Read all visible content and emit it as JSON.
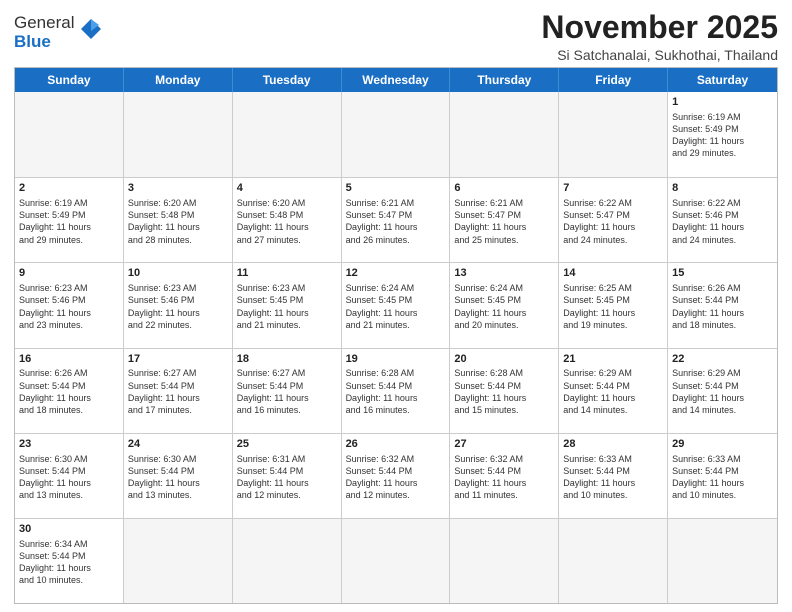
{
  "header": {
    "logo_general": "General",
    "logo_blue": "Blue",
    "month_title": "November 2025",
    "location": "Si Satchanalai, Sukhothai, Thailand"
  },
  "weekdays": [
    "Sunday",
    "Monday",
    "Tuesday",
    "Wednesday",
    "Thursday",
    "Friday",
    "Saturday"
  ],
  "rows": [
    [
      {
        "day": "",
        "text": "",
        "empty": true
      },
      {
        "day": "",
        "text": "",
        "empty": true
      },
      {
        "day": "",
        "text": "",
        "empty": true
      },
      {
        "day": "",
        "text": "",
        "empty": true
      },
      {
        "day": "",
        "text": "",
        "empty": true
      },
      {
        "day": "",
        "text": "",
        "empty": true
      },
      {
        "day": "1",
        "text": "Sunrise: 6:19 AM\nSunset: 5:49 PM\nDaylight: 11 hours\nand 29 minutes.",
        "empty": false
      }
    ],
    [
      {
        "day": "2",
        "text": "Sunrise: 6:19 AM\nSunset: 5:49 PM\nDaylight: 11 hours\nand 29 minutes.",
        "empty": false
      },
      {
        "day": "3",
        "text": "Sunrise: 6:20 AM\nSunset: 5:48 PM\nDaylight: 11 hours\nand 28 minutes.",
        "empty": false
      },
      {
        "day": "4",
        "text": "Sunrise: 6:20 AM\nSunset: 5:48 PM\nDaylight: 11 hours\nand 27 minutes.",
        "empty": false
      },
      {
        "day": "5",
        "text": "Sunrise: 6:21 AM\nSunset: 5:47 PM\nDaylight: 11 hours\nand 26 minutes.",
        "empty": false
      },
      {
        "day": "6",
        "text": "Sunrise: 6:21 AM\nSunset: 5:47 PM\nDaylight: 11 hours\nand 25 minutes.",
        "empty": false
      },
      {
        "day": "7",
        "text": "Sunrise: 6:22 AM\nSunset: 5:47 PM\nDaylight: 11 hours\nand 24 minutes.",
        "empty": false
      },
      {
        "day": "8",
        "text": "Sunrise: 6:22 AM\nSunset: 5:46 PM\nDaylight: 11 hours\nand 24 minutes.",
        "empty": false
      }
    ],
    [
      {
        "day": "9",
        "text": "Sunrise: 6:23 AM\nSunset: 5:46 PM\nDaylight: 11 hours\nand 23 minutes.",
        "empty": false
      },
      {
        "day": "10",
        "text": "Sunrise: 6:23 AM\nSunset: 5:46 PM\nDaylight: 11 hours\nand 22 minutes.",
        "empty": false
      },
      {
        "day": "11",
        "text": "Sunrise: 6:23 AM\nSunset: 5:45 PM\nDaylight: 11 hours\nand 21 minutes.",
        "empty": false
      },
      {
        "day": "12",
        "text": "Sunrise: 6:24 AM\nSunset: 5:45 PM\nDaylight: 11 hours\nand 21 minutes.",
        "empty": false
      },
      {
        "day": "13",
        "text": "Sunrise: 6:24 AM\nSunset: 5:45 PM\nDaylight: 11 hours\nand 20 minutes.",
        "empty": false
      },
      {
        "day": "14",
        "text": "Sunrise: 6:25 AM\nSunset: 5:45 PM\nDaylight: 11 hours\nand 19 minutes.",
        "empty": false
      },
      {
        "day": "15",
        "text": "Sunrise: 6:26 AM\nSunset: 5:44 PM\nDaylight: 11 hours\nand 18 minutes.",
        "empty": false
      }
    ],
    [
      {
        "day": "16",
        "text": "Sunrise: 6:26 AM\nSunset: 5:44 PM\nDaylight: 11 hours\nand 18 minutes.",
        "empty": false
      },
      {
        "day": "17",
        "text": "Sunrise: 6:27 AM\nSunset: 5:44 PM\nDaylight: 11 hours\nand 17 minutes.",
        "empty": false
      },
      {
        "day": "18",
        "text": "Sunrise: 6:27 AM\nSunset: 5:44 PM\nDaylight: 11 hours\nand 16 minutes.",
        "empty": false
      },
      {
        "day": "19",
        "text": "Sunrise: 6:28 AM\nSunset: 5:44 PM\nDaylight: 11 hours\nand 16 minutes.",
        "empty": false
      },
      {
        "day": "20",
        "text": "Sunrise: 6:28 AM\nSunset: 5:44 PM\nDaylight: 11 hours\nand 15 minutes.",
        "empty": false
      },
      {
        "day": "21",
        "text": "Sunrise: 6:29 AM\nSunset: 5:44 PM\nDaylight: 11 hours\nand 14 minutes.",
        "empty": false
      },
      {
        "day": "22",
        "text": "Sunrise: 6:29 AM\nSunset: 5:44 PM\nDaylight: 11 hours\nand 14 minutes.",
        "empty": false
      }
    ],
    [
      {
        "day": "23",
        "text": "Sunrise: 6:30 AM\nSunset: 5:44 PM\nDaylight: 11 hours\nand 13 minutes.",
        "empty": false
      },
      {
        "day": "24",
        "text": "Sunrise: 6:30 AM\nSunset: 5:44 PM\nDaylight: 11 hours\nand 13 minutes.",
        "empty": false
      },
      {
        "day": "25",
        "text": "Sunrise: 6:31 AM\nSunset: 5:44 PM\nDaylight: 11 hours\nand 12 minutes.",
        "empty": false
      },
      {
        "day": "26",
        "text": "Sunrise: 6:32 AM\nSunset: 5:44 PM\nDaylight: 11 hours\nand 12 minutes.",
        "empty": false
      },
      {
        "day": "27",
        "text": "Sunrise: 6:32 AM\nSunset: 5:44 PM\nDaylight: 11 hours\nand 11 minutes.",
        "empty": false
      },
      {
        "day": "28",
        "text": "Sunrise: 6:33 AM\nSunset: 5:44 PM\nDaylight: 11 hours\nand 10 minutes.",
        "empty": false
      },
      {
        "day": "29",
        "text": "Sunrise: 6:33 AM\nSunset: 5:44 PM\nDaylight: 11 hours\nand 10 minutes.",
        "empty": false
      }
    ],
    [
      {
        "day": "30",
        "text": "Sunrise: 6:34 AM\nSunset: 5:44 PM\nDaylight: 11 hours\nand 10 minutes.",
        "empty": false
      },
      {
        "day": "",
        "text": "",
        "empty": true
      },
      {
        "day": "",
        "text": "",
        "empty": true
      },
      {
        "day": "",
        "text": "",
        "empty": true
      },
      {
        "day": "",
        "text": "",
        "empty": true
      },
      {
        "day": "",
        "text": "",
        "empty": true
      },
      {
        "day": "",
        "text": "",
        "empty": true
      }
    ]
  ]
}
